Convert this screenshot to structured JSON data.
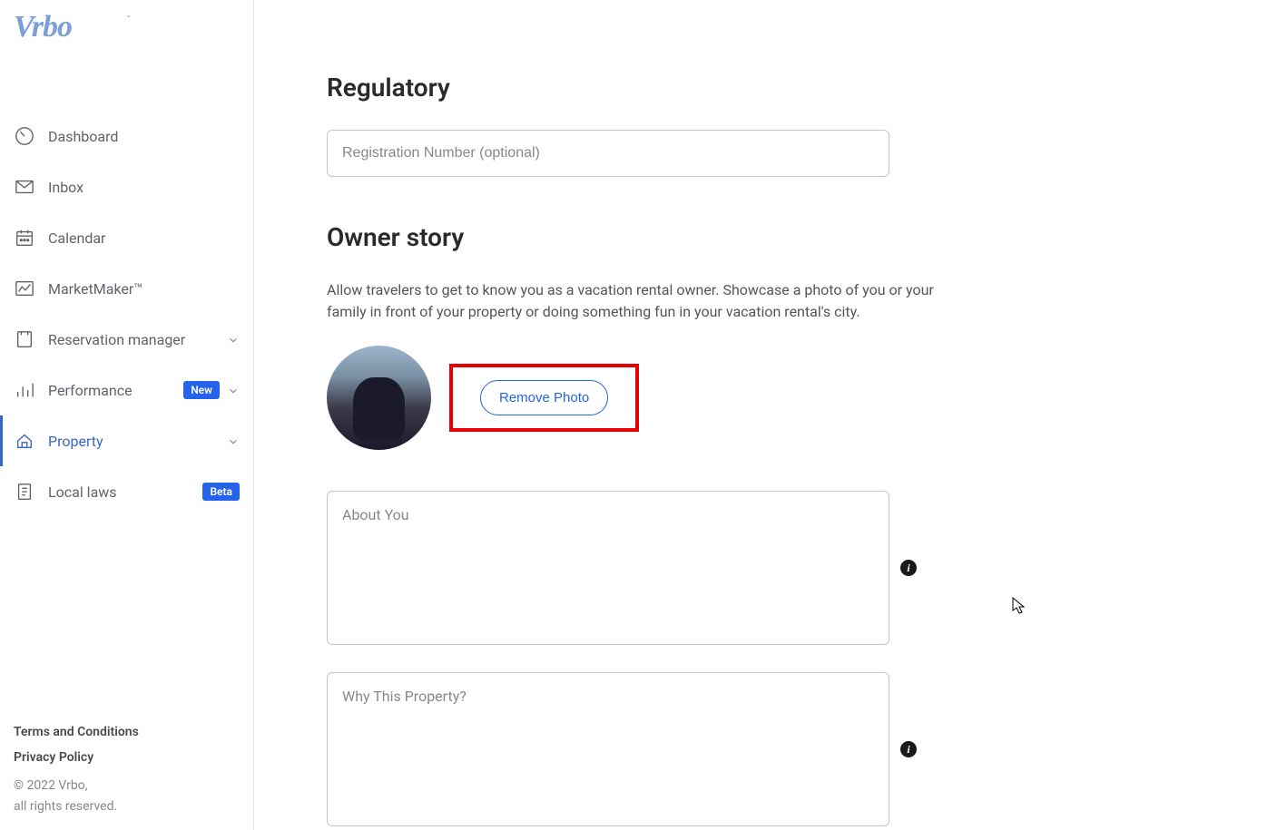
{
  "brand": {
    "name": "Vrbo"
  },
  "sidebar": {
    "items": [
      {
        "label": "Dashboard",
        "icon": "dashboard-icon",
        "active": false,
        "chevron": false,
        "badge": null
      },
      {
        "label": "Inbox",
        "icon": "inbox-icon",
        "active": false,
        "chevron": false,
        "badge": null
      },
      {
        "label": "Calendar",
        "icon": "calendar-icon",
        "active": false,
        "chevron": false,
        "badge": null
      },
      {
        "label": "MarketMaker™",
        "icon": "marketmaker-icon",
        "active": false,
        "chevron": false,
        "badge": null
      },
      {
        "label": "Reservation manager",
        "icon": "reservation-icon",
        "active": false,
        "chevron": true,
        "badge": null
      },
      {
        "label": "Performance",
        "icon": "performance-icon",
        "active": false,
        "chevron": true,
        "badge": "New"
      },
      {
        "label": "Property",
        "icon": "property-icon",
        "active": true,
        "chevron": true,
        "badge": null
      },
      {
        "label": "Local laws",
        "icon": "locallaws-icon",
        "active": false,
        "chevron": false,
        "badge": "Beta"
      }
    ],
    "footer": {
      "terms": "Terms and Conditions",
      "privacy": "Privacy Policy",
      "copyright1": "© 2022 Vrbo,",
      "copyright2": "all rights reserved."
    }
  },
  "main": {
    "regulatory": {
      "heading": "Regulatory",
      "registration_placeholder": "Registration Number (optional)"
    },
    "owner_story": {
      "heading": "Owner story",
      "description": "Allow travelers to get to know you as a vacation rental owner. Showcase a photo of you or your family in front of your property or doing something fun in your vacation rental's city.",
      "remove_photo_label": "Remove Photo",
      "about_you_placeholder": "About You",
      "why_property_placeholder": "Why This Property?"
    }
  }
}
